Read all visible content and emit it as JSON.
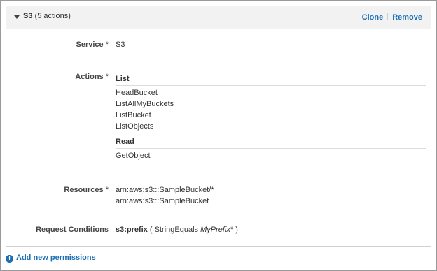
{
  "statement": {
    "service_name": "S3",
    "action_count": "(5 actions)",
    "clone_label": "Clone",
    "remove_label": "Remove"
  },
  "service": {
    "label": "Service",
    "required": "*",
    "value": "S3"
  },
  "actions": {
    "label": "Actions",
    "required": "*",
    "groups": [
      {
        "heading": "List",
        "items": [
          "HeadBucket",
          "ListAllMyBuckets",
          "ListBucket",
          "ListObjects"
        ]
      },
      {
        "heading": "Read",
        "items": [
          "GetObject"
        ]
      }
    ]
  },
  "resources": {
    "label": "Resources",
    "required": "*",
    "items": [
      "arn:aws:s3:::SampleBucket/*",
      "arn:aws:s3:::SampleBucket"
    ]
  },
  "conditions": {
    "label": "Request Conditions",
    "key": "s3:prefix",
    "open": "( StringEquals",
    "value": "MyPrefix",
    "close": "* )"
  },
  "footer": {
    "add_label": "Add new permissions"
  },
  "colors": {
    "link": "#1a6fb5",
    "header_bg": "#f2f2f2"
  }
}
